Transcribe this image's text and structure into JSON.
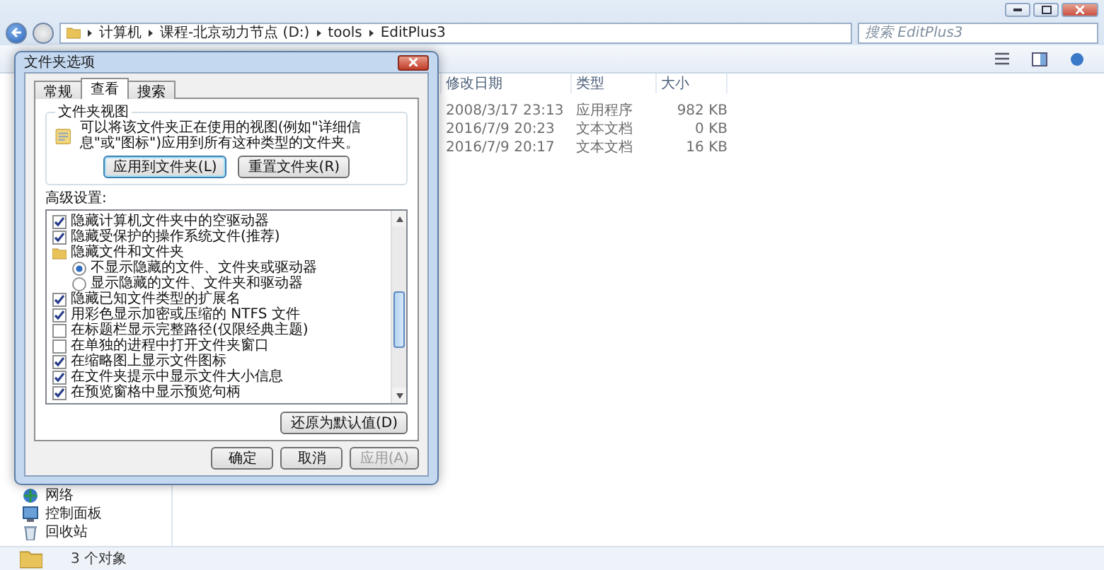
{
  "explorer": {
    "breadcrumbs": [
      "计算机",
      "课程-北京动力节点 (D:)",
      "tools",
      "EditPlus3"
    ],
    "search": {
      "placeholder": "搜索 EditPlus3"
    },
    "columns": [
      "修改日期",
      "类型",
      "大小"
    ],
    "rows": [
      {
        "modified": "2008/3/17 23:13",
        "type": "应用程序",
        "size": "982 KB"
      },
      {
        "modified": "2016/7/9 20:23",
        "type": "文本文档",
        "size": "0 KB"
      },
      {
        "modified": "2016/7/9 20:17",
        "type": "文本文档",
        "size": "16 KB"
      }
    ],
    "nav_items": [
      {
        "label": "网络",
        "kind": "network"
      },
      {
        "label": "控制面板",
        "kind": "control_panel"
      },
      {
        "label": "回收站",
        "kind": "recycle_bin"
      }
    ],
    "status": "3 个对象"
  },
  "dialog": {
    "title": "文件夹选项",
    "tabs": [
      {
        "label": "常规",
        "selected": false
      },
      {
        "label": "查看",
        "selected": true
      },
      {
        "label": "搜索",
        "selected": false
      }
    ],
    "folder_views": {
      "title": "文件夹视图",
      "text": "可以将该文件夹正在使用的视图(例如\"详细信息\"或\"图标\")应用到所有这种类型的文件夹。",
      "buttons": [
        {
          "label": "应用到文件夹(L)",
          "focused": true
        },
        {
          "label": "重置文件夹(R)",
          "focused": false
        }
      ]
    },
    "advanced_label": "高级设置:",
    "settings": [
      {
        "kind": "checkbox",
        "label": "隐藏计算机文件夹中的空驱动器",
        "checked": true
      },
      {
        "kind": "checkbox",
        "label": "隐藏受保护的操作系统文件(推荐)",
        "checked": true
      },
      {
        "kind": "folder",
        "label": "隐藏文件和文件夹",
        "children": [
          {
            "kind": "radio",
            "label": "不显示隐藏的文件、文件夹或驱动器",
            "selected": true
          },
          {
            "kind": "radio",
            "label": "显示隐藏的文件、文件夹和驱动器",
            "selected": false
          }
        ]
      },
      {
        "kind": "checkbox",
        "label": "隐藏已知文件类型的扩展名",
        "checked": true
      },
      {
        "kind": "checkbox",
        "label": "用彩色显示加密或压缩的 NTFS 文件",
        "checked": true
      },
      {
        "kind": "checkbox",
        "label": "在标题栏显示完整路径(仅限经典主题)",
        "checked": false
      },
      {
        "kind": "checkbox",
        "label": "在单独的进程中打开文件夹窗口",
        "checked": false
      },
      {
        "kind": "checkbox",
        "label": "在缩略图上显示文件图标",
        "checked": true
      },
      {
        "kind": "checkbox",
        "label": "在文件夹提示中显示文件大小信息",
        "checked": true
      },
      {
        "kind": "checkbox",
        "label": "在预览窗格中显示预览句柄",
        "checked": true
      }
    ],
    "restore_button": "还原为默认值(D)",
    "footer_buttons": [
      {
        "label": "确定",
        "disabled": false
      },
      {
        "label": "取消",
        "disabled": false
      },
      {
        "label": "应用(A)",
        "disabled": true
      }
    ]
  }
}
